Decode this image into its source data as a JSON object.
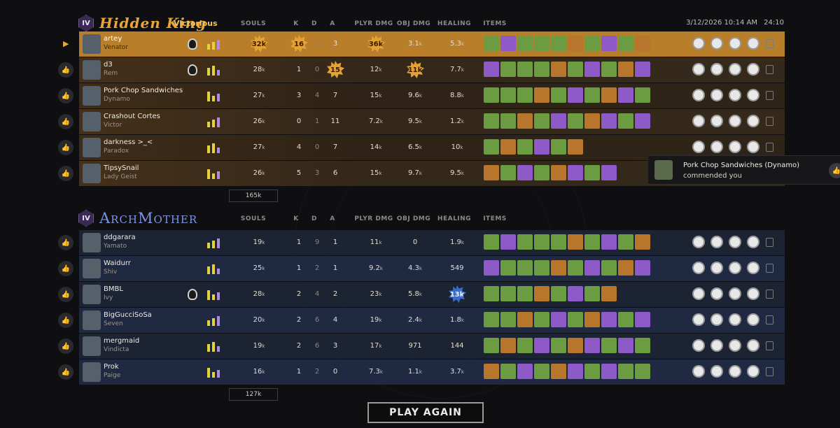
{
  "timestamp": "3/12/2026 10:14 AM",
  "duration": "24:10",
  "columns": [
    "SOULS",
    "K",
    "D",
    "A",
    "PLYR DMG",
    "OBJ DMG",
    "HEALING",
    "ITEMS"
  ],
  "teams": [
    {
      "name": "Hidden King",
      "rank": "IV",
      "result": "Victorious",
      "total_souls": "165k",
      "players": [
        {
          "name": "artey",
          "hero": "Venator",
          "souls": "32",
          "k": "16",
          "d": "1",
          "a": "3",
          "pdmg": "36",
          "odmg": "3.1",
          "heal": "5.3"
        },
        {
          "name": "d3",
          "hero": "Rem",
          "souls": "28",
          "k": "1",
          "d": "0",
          "a": "15",
          "pdmg": "12",
          "odmg": "11",
          "heal": "7.7"
        },
        {
          "name": "Pork Chop Sandwiches",
          "hero": "Dynamo",
          "souls": "27",
          "k": "3",
          "d": "4",
          "a": "7",
          "pdmg": "15",
          "odmg": "9.6",
          "heal": "8.8"
        },
        {
          "name": "Crashout Cortes",
          "hero": "Victor",
          "souls": "26",
          "k": "0",
          "d": "1",
          "a": "11",
          "pdmg": "7.2",
          "odmg": "9.5",
          "heal": "1.2"
        },
        {
          "name": "darkness >_<",
          "hero": "Paradox",
          "souls": "27",
          "k": "4",
          "d": "0",
          "a": "7",
          "pdmg": "14",
          "odmg": "6.5",
          "heal": "10"
        },
        {
          "name": "TipsySnail",
          "hero": "Lady Geist",
          "souls": "26",
          "k": "5",
          "d": "3",
          "a": "6",
          "pdmg": "15",
          "odmg": "9.7",
          "heal": "9.5"
        }
      ]
    },
    {
      "name": "ArchMother",
      "rank": "IV",
      "result": "",
      "total_souls": "127k",
      "players": [
        {
          "name": "ddgarara",
          "hero": "Yamato",
          "souls": "19",
          "k": "1",
          "d": "9",
          "a": "1",
          "pdmg": "11",
          "odmg": "0",
          "heal": "1.9"
        },
        {
          "name": "Waidurr",
          "hero": "Shiv",
          "souls": "25",
          "k": "1",
          "d": "2",
          "a": "1",
          "pdmg": "9.2",
          "odmg": "4.3",
          "heal": "549"
        },
        {
          "name": "BMBL",
          "hero": "Ivy",
          "souls": "28",
          "k": "2",
          "d": "4",
          "a": "2",
          "pdmg": "23",
          "odmg": "5.8",
          "heal": "13"
        },
        {
          "name": "BigGucciSoSa",
          "hero": "Seven",
          "souls": "20",
          "k": "2",
          "d": "6",
          "a": "4",
          "pdmg": "19",
          "odmg": "2.4",
          "heal": "1.8"
        },
        {
          "name": "mergmaid",
          "hero": "Vindicta",
          "souls": "19",
          "k": "2",
          "d": "6",
          "a": "3",
          "pdmg": "17",
          "odmg": "971",
          "heal": "144"
        },
        {
          "name": "Prok",
          "hero": "Paige",
          "souls": "16",
          "k": "1",
          "d": "2",
          "a": "0",
          "pdmg": "7.3",
          "odmg": "1.1",
          "heal": "3.7"
        }
      ]
    }
  ],
  "toast": {
    "line1": "Pork Chop Sandwiches (Dynamo)",
    "line2": "commended you"
  },
  "play_again": "PLAY AGAIN",
  "unit_k": "k",
  "icons": {
    "commend": "thumbs-up-icon",
    "copy": "copy-icon",
    "rank": "rank-iv-icon"
  },
  "colors": {
    "king": "#e7a53a",
    "mother": "#7e93e6",
    "highlight": "#b87e2a"
  }
}
